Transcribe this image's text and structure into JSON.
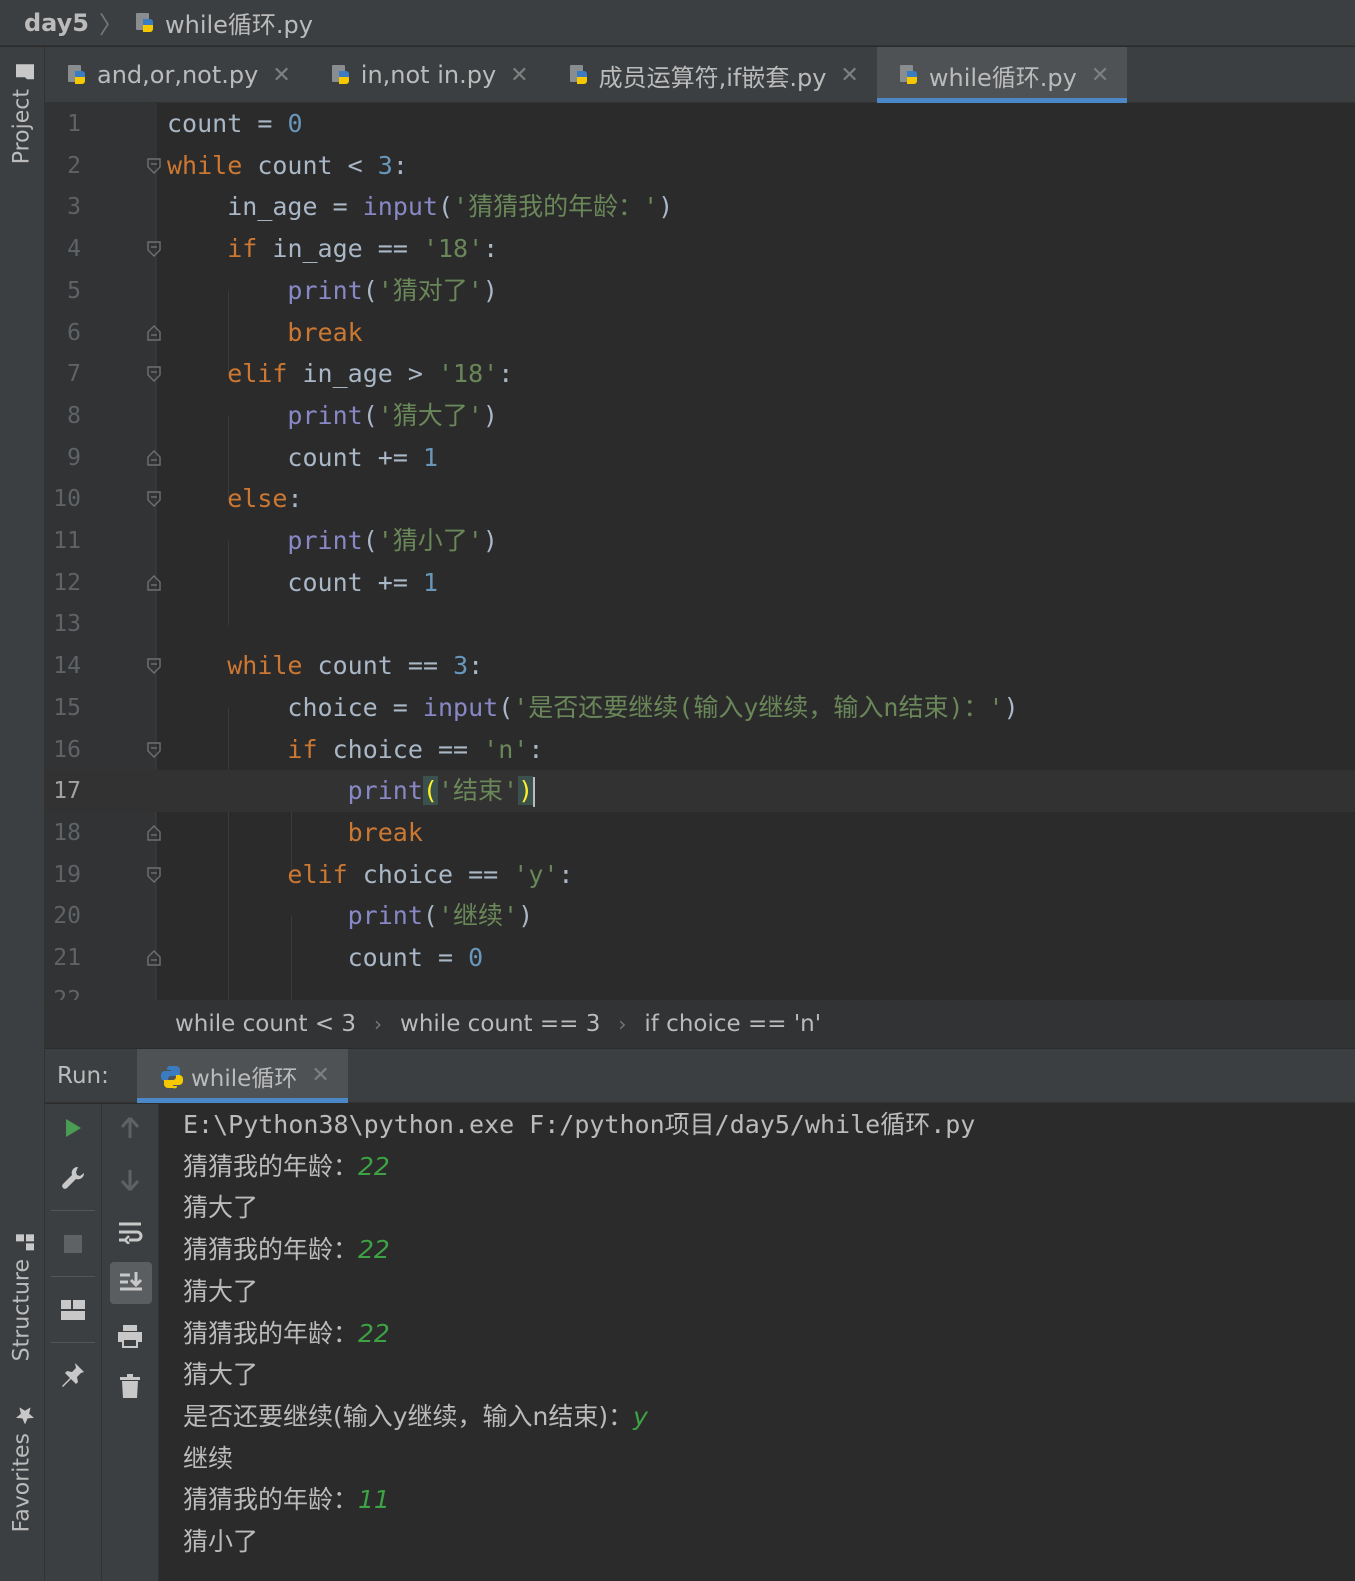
{
  "breadcrumb": {
    "project": "day5",
    "file": "while循环.py"
  },
  "side_tabs": {
    "project": "Project",
    "structure": "Structure",
    "favorites": "Favorites"
  },
  "tabs": [
    {
      "label": "and,or,not.py",
      "active": false
    },
    {
      "label": "in,not in.py",
      "active": false
    },
    {
      "label": "成员运算符,if嵌套.py",
      "active": false
    },
    {
      "label": "while循环.py",
      "active": true
    }
  ],
  "editor": {
    "current_line": 17,
    "line_numbers": [
      "1",
      "2",
      "3",
      "4",
      "5",
      "6",
      "7",
      "8",
      "9",
      "10",
      "11",
      "12",
      "13",
      "14",
      "15",
      "16",
      "17",
      "18",
      "19",
      "20",
      "21",
      "22"
    ],
    "lines": [
      "count = 0",
      "while count < 3:",
      "    in_age = input('猜猜我的年龄：')",
      "    if in_age == '18':",
      "        print('猜对了')",
      "        break",
      "    elif in_age > '18':",
      "        print('猜大了')",
      "        count += 1",
      "    else:",
      "        print('猜小了')",
      "        count += 1",
      "",
      "    while count == 3:",
      "        choice = input('是否还要继续(输入y继续，输入n结束)：')",
      "        if choice == 'n':",
      "            print('结束')",
      "            break",
      "        elif choice == 'y':",
      "            print('继续')",
      "            count = 0"
    ]
  },
  "nav_crumbs": [
    "while count < 3",
    "while count == 3",
    "if choice == 'n'"
  ],
  "run": {
    "label": "Run:",
    "tab": "while循环",
    "console": [
      {
        "text": "E:\\Python38\\python.exe F:/python项目/day5/while循环.py",
        "input": ""
      },
      {
        "text": "猜猜我的年龄：",
        "input": "22"
      },
      {
        "text": "猜大了",
        "input": ""
      },
      {
        "text": "猜猜我的年龄：",
        "input": "22"
      },
      {
        "text": "猜大了",
        "input": ""
      },
      {
        "text": "猜猜我的年龄：",
        "input": "22"
      },
      {
        "text": "猜大了",
        "input": ""
      },
      {
        "text": "是否还要继续(输入y继续，输入n结束)：",
        "input": "y"
      },
      {
        "text": "继续",
        "input": ""
      },
      {
        "text": "猜猜我的年龄：",
        "input": "11"
      },
      {
        "text": "猜小了",
        "input": ""
      }
    ]
  },
  "icons": {
    "python_file": "python-file-icon",
    "run": "run-icon",
    "wrench": "wrench-icon",
    "stop": "stop-icon",
    "layout": "layout-icon",
    "pin": "pin-icon",
    "up": "arrow-up-icon",
    "down": "arrow-down-icon",
    "soft_wrap": "soft-wrap-icon",
    "scroll_end": "scroll-to-end-icon",
    "print": "print-icon",
    "trash": "trash-icon"
  },
  "colors": {
    "keyword": "#cc7832",
    "number": "#6897bb",
    "string": "#6a8759",
    "builtin": "#8888c6",
    "identifier": "#a9b7c6",
    "console_input": "#3da244",
    "tab_underline": "#4a88c7"
  }
}
